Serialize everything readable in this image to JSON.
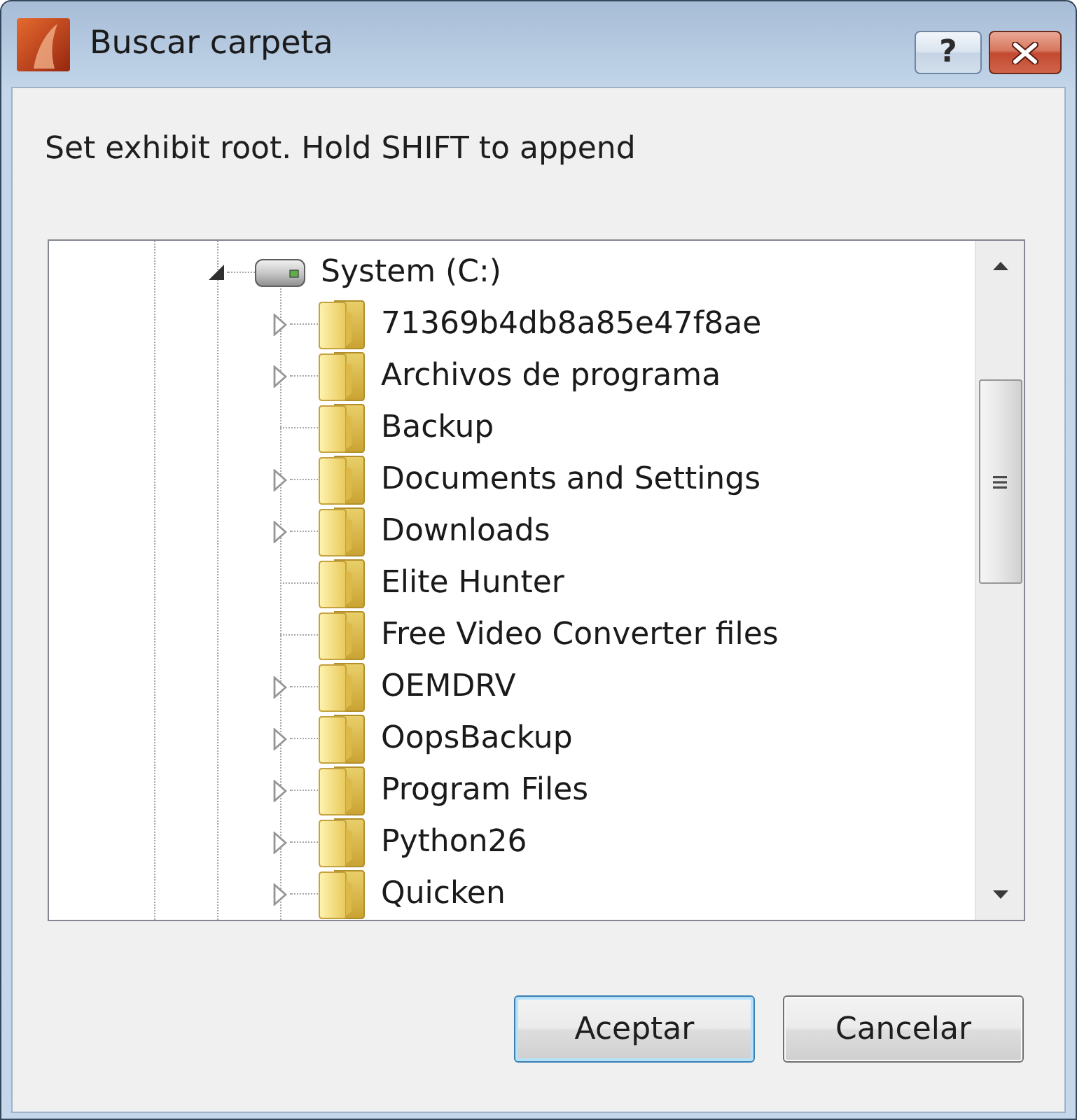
{
  "window": {
    "title": "Buscar carpeta"
  },
  "help_button": {
    "label": "?"
  },
  "prompt": "Set exhibit root. Hold SHIFT to append",
  "tree": [
    {
      "label": "System (C:)",
      "kind": "drive",
      "expandable": true,
      "expanded": true,
      "selected": false,
      "children": [
        {
          "label": "71369b4db8a85e47f8ae",
          "kind": "folder",
          "expandable": true,
          "expanded": false,
          "selected": false
        },
        {
          "label": "Archivos de programa",
          "kind": "folder",
          "expandable": true,
          "expanded": false,
          "selected": false
        },
        {
          "label": "Backup",
          "kind": "folder",
          "expandable": false,
          "selected": false
        },
        {
          "label": "Documents and Settings",
          "kind": "folder",
          "expandable": true,
          "expanded": false,
          "selected": false
        },
        {
          "label": "Downloads",
          "kind": "folder",
          "expandable": true,
          "expanded": false,
          "selected": false
        },
        {
          "label": "Elite Hunter",
          "kind": "folder",
          "expandable": false,
          "selected": false
        },
        {
          "label": "Free Video Converter files",
          "kind": "folder",
          "expandable": false,
          "selected": false
        },
        {
          "label": "OEMDRV",
          "kind": "folder",
          "expandable": true,
          "expanded": false,
          "selected": false
        },
        {
          "label": "OopsBackup",
          "kind": "folder",
          "expandable": true,
          "expanded": false,
          "selected": false
        },
        {
          "label": "Program Files",
          "kind": "folder",
          "expandable": true,
          "expanded": false,
          "selected": false
        },
        {
          "label": "Python26",
          "kind": "folder",
          "expandable": true,
          "expanded": false,
          "selected": false
        },
        {
          "label": "Quicken",
          "kind": "folder",
          "expandable": true,
          "expanded": false,
          "selected": false
        }
      ]
    }
  ],
  "buttons": [
    {
      "label": "Aceptar",
      "default": true
    },
    {
      "label": "Cancelar",
      "default": false
    }
  ]
}
